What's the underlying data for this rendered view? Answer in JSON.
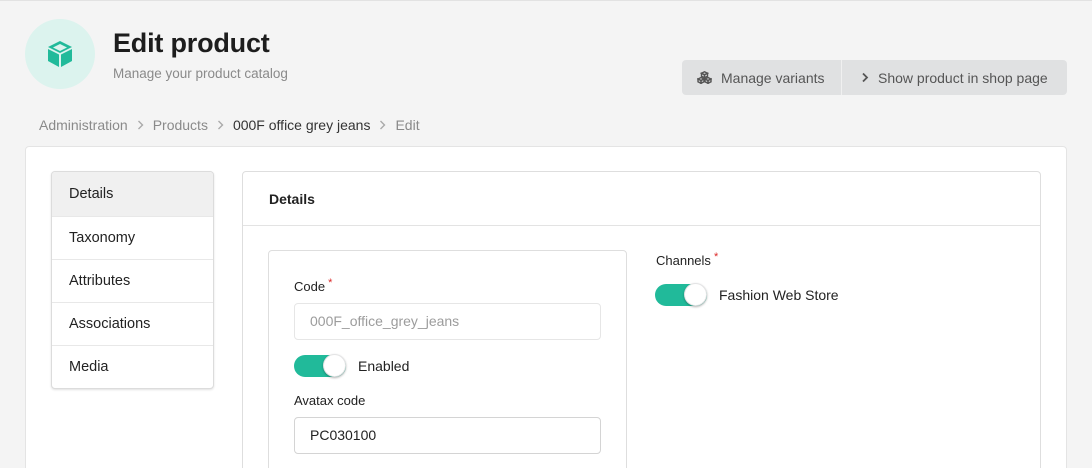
{
  "header": {
    "title": "Edit product",
    "subtitle": "Manage your product catalog",
    "icon": "cube-icon",
    "accent_color": "#21ba9a"
  },
  "actions": {
    "manage_variants": {
      "label": "Manage variants",
      "icon": "cubes-icon"
    },
    "show_in_shop": {
      "label": "Show product in shop page",
      "icon": "chevron-right-icon"
    }
  },
  "breadcrumb": {
    "items": [
      "Administration",
      "Products",
      "000F office grey jeans",
      "Edit"
    ]
  },
  "side_menu": {
    "items": [
      {
        "label": "Details",
        "active": true
      },
      {
        "label": "Taxonomy"
      },
      {
        "label": "Attributes"
      },
      {
        "label": "Associations"
      },
      {
        "label": "Media"
      }
    ]
  },
  "details": {
    "title": "Details",
    "code": {
      "label": "Code",
      "value": "000F_office_grey_jeans",
      "required": "*"
    },
    "enabled": {
      "label": "Enabled",
      "checked": true
    },
    "avatax": {
      "label": "Avatax code",
      "value": "PC030100"
    },
    "channels": {
      "label": "Channels",
      "required": "*",
      "items": [
        {
          "label": "Fashion Web Store",
          "checked": true
        }
      ]
    }
  }
}
